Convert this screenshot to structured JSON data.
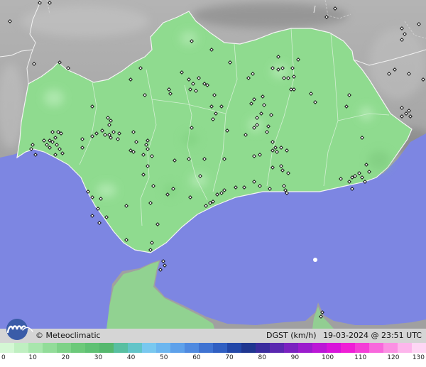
{
  "credit": "© Meteoclimatic",
  "caption": {
    "variable": "DGST (km/h)",
    "timestamp": "19-03-2024 @ 23:51 UTC"
  },
  "legend": {
    "unit": "km/h",
    "ticks": [
      "0",
      "10",
      "20",
      "30",
      "40",
      "50",
      "60",
      "70",
      "80",
      "90",
      "100",
      "110",
      "120",
      "130"
    ],
    "colors": [
      "#d4f7d4",
      "#bfefc1",
      "#a8e6ad",
      "#92dc99",
      "#7ed288",
      "#6cc97a",
      "#5fc174",
      "#55b86e",
      "#58bfa1",
      "#62c4c8",
      "#79c8ef",
      "#6cb6ef",
      "#5ea1ea",
      "#4f8ae0",
      "#3f73d2",
      "#305fc2",
      "#2247a8",
      "#1f3690",
      "#3a2c9e",
      "#5a28b0",
      "#7a22c0",
      "#9b1ccd",
      "#bb17d6",
      "#d814da",
      "#ef1ed6",
      "#f43ed7",
      "#f868dc",
      "#fb90e3",
      "#fdb6ec",
      "#fed6f4"
    ]
  },
  "colors": {
    "sea": "#7d86e2",
    "land_outside": "#9c9c9c",
    "region_fill": "#8fdb8f",
    "region_stroke": "#f6f6f6",
    "station": "#000000"
  }
}
